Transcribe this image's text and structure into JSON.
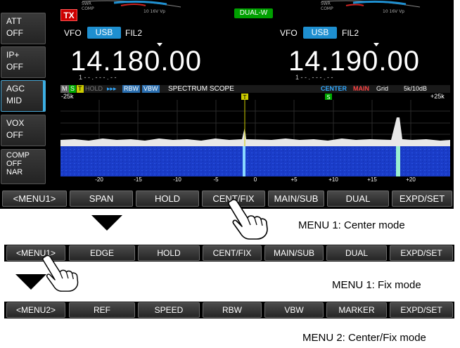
{
  "left_keys": [
    {
      "top": "ATT",
      "bottom": "OFF"
    },
    {
      "top": "IP+",
      "bottom": "OFF"
    },
    {
      "top": "AGC",
      "bottom": "MID"
    },
    {
      "top": "VOX",
      "bottom": "OFF"
    },
    {
      "top": "COMP",
      "middle": "OFF",
      "bottom": "NAR"
    }
  ],
  "status": {
    "tx": "TX",
    "dual_watch": "DUAL-W"
  },
  "main": {
    "vfo": "VFO",
    "mode": "USB",
    "filter": "FIL2",
    "freq": "14.180.00",
    "sub": "1 - - . - - - . - -"
  },
  "sub": {
    "vfo": "VFO",
    "mode": "USB",
    "filter": "FIL2",
    "freq": "14.190.00",
    "sub": "1 - - . - - - . - -"
  },
  "scope": {
    "title": "SPECTRUM SCOPE",
    "tags": [
      "M",
      "S",
      "T",
      "HOLD",
      "▸▸▸",
      "RBW",
      "VBW"
    ],
    "mode": "CENTER",
    "band": "MAIN",
    "grid": "Grid",
    "scale": "5k/10dB",
    "span_left": "-25k",
    "span_right": "+25k",
    "marker_t": "T",
    "marker_s": "S",
    "ticks": [
      "-20",
      "-15",
      "-10",
      "-5",
      "0",
      "+5",
      "+10",
      "+15",
      "+20"
    ]
  },
  "menu_center": [
    "<MENU1>",
    "SPAN",
    "HOLD",
    "CENT/FIX",
    "MAIN/SUB",
    "DUAL",
    "EXPD/SET"
  ],
  "menu_fix": [
    "<MENU1>",
    "EDGE",
    "HOLD",
    "CENT/FIX",
    "MAIN/SUB",
    "DUAL",
    "EXPD/SET"
  ],
  "menu_2": [
    "<MENU2>",
    "REF",
    "SPEED",
    "RBW",
    "VBW",
    "MARKER",
    "EXPD/SET"
  ],
  "captions": {
    "center": "MENU 1: Center mode",
    "fix": "MENU 1: Fix mode",
    "menu2": "MENU 2: Center/Fix mode"
  },
  "colors": {
    "accent": "#1e8fd0",
    "tx": "#cc0000",
    "dualw": "#00a000",
    "waterfall": "#1a3cc8"
  }
}
